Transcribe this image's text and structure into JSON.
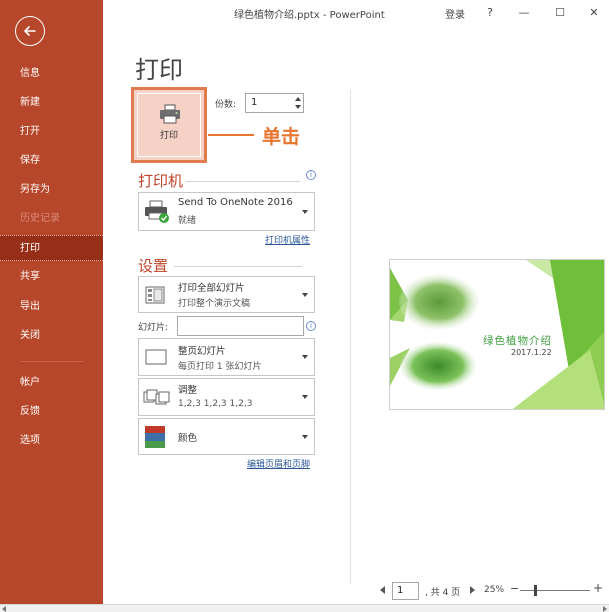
{
  "titlebar": {
    "title": "绿色植物介绍.pptx  -  PowerPoint",
    "login": "登录",
    "help": "?",
    "minimize": "—",
    "restore": "☐",
    "close": "✕"
  },
  "sidebar": {
    "items": [
      {
        "label": "信息"
      },
      {
        "label": "新建"
      },
      {
        "label": "打开"
      },
      {
        "label": "保存"
      },
      {
        "label": "另存为"
      },
      {
        "label": "历史记录"
      },
      {
        "label": "打印"
      },
      {
        "label": "共享"
      },
      {
        "label": "导出"
      },
      {
        "label": "关闭"
      },
      {
        "label": "帐户"
      },
      {
        "label": "反馈"
      },
      {
        "label": "选项"
      }
    ],
    "active": "打印",
    "colors": {
      "background": "#b7472a",
      "active": "#962e18"
    }
  },
  "main": {
    "title": "打印",
    "print_button_label": "打印",
    "annotation": "单击",
    "copies_label": "份数:",
    "copies_value": "1",
    "printer_section": "打印机",
    "printer_name": "Send To OneNote 2016",
    "printer_status": "就绪",
    "printer_properties": "打印机属性",
    "settings_section": "设置",
    "setting_range_main": "打印全部幻灯片",
    "setting_range_sub": "打印整个演示文稿",
    "slides_label": "幻灯片:",
    "slides_value": "",
    "setting_layout_main": "整页幻灯片",
    "setting_layout_sub": "每页打印 1 张幻灯片",
    "setting_collate_main": "调整",
    "setting_collate_sub": "1,2,3    1,2,3    1,2,3",
    "setting_color_main": "颜色",
    "edit_header_footer": "编辑页眉和页脚",
    "accent_color": "#c0452b",
    "annotation_color": "#e8742e"
  },
  "preview": {
    "slide_title": "绿色植物介绍",
    "slide_date": "2017.1.22",
    "page_input": "1",
    "page_total": ", 共 4 页",
    "zoom_level": "25%"
  }
}
